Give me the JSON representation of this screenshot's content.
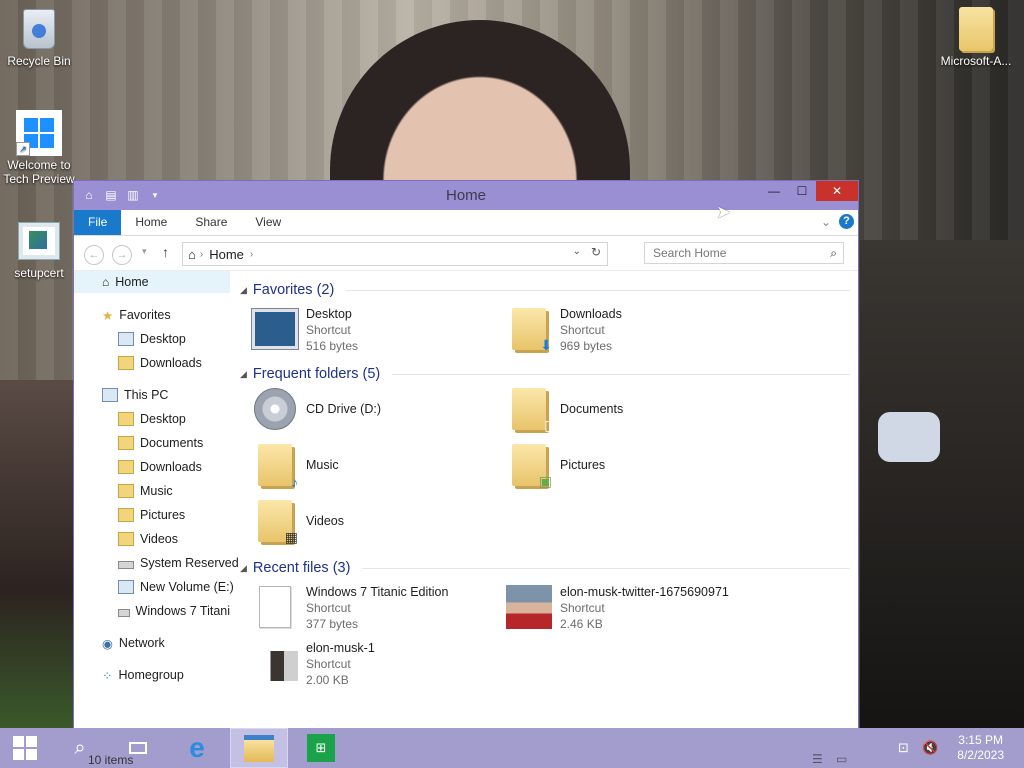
{
  "desktop": {
    "icons": [
      {
        "label": "Recycle Bin"
      },
      {
        "label": "Welcome to Tech Preview"
      },
      {
        "label": "setupcert"
      },
      {
        "label": "Microsoft-A..."
      }
    ]
  },
  "window": {
    "title": "Home",
    "ribbon_tabs": [
      "File",
      "Home",
      "Share",
      "View"
    ],
    "address": {
      "segments": [
        "Home"
      ]
    },
    "search": {
      "placeholder": "Search Home"
    },
    "nav": {
      "home": "Home",
      "favorites": "Favorites",
      "fav_items": [
        "Desktop",
        "Downloads"
      ],
      "this_pc": "This PC",
      "pc_items": [
        "Desktop",
        "Documents",
        "Downloads",
        "Music",
        "Pictures",
        "Videos",
        "System Reserved",
        "New Volume (E:)",
        "Windows 7 Titani"
      ],
      "network": "Network",
      "homegroup": "Homegroup"
    },
    "groups": {
      "favorites": "Favorites (2)",
      "frequent": "Frequent folders (5)",
      "recent": "Recent files (3)"
    },
    "favorites": [
      {
        "name": "Desktop",
        "type": "Shortcut",
        "size": "516 bytes"
      },
      {
        "name": "Downloads",
        "type": "Shortcut",
        "size": "969 bytes"
      }
    ],
    "frequent": [
      {
        "name": "CD Drive (D:)"
      },
      {
        "name": "Documents"
      },
      {
        "name": "Music"
      },
      {
        "name": "Pictures"
      },
      {
        "name": "Videos"
      }
    ],
    "recent": [
      {
        "name": "Windows 7 Titanic Edition",
        "type": "Shortcut",
        "size": "377 bytes"
      },
      {
        "name": "elon-musk-twitter-1675690971",
        "type": "Shortcut",
        "size": "2.46 KB"
      },
      {
        "name": "elon-musk-1",
        "type": "Shortcut",
        "size": "2.00 KB"
      }
    ],
    "status": "10 items"
  },
  "taskbar": {
    "time": "3:15 PM",
    "date": "8/2/2023"
  },
  "colors": {
    "titlebar": "#9b8fd3",
    "taskbar": "#a39dce",
    "accent": "#1979ca",
    "close": "#c8322a"
  }
}
